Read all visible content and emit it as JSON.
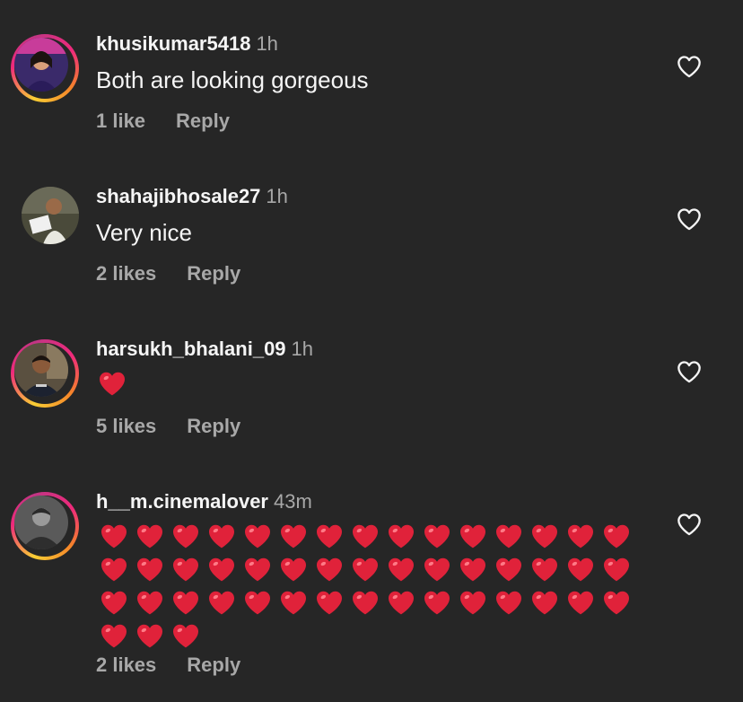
{
  "comments": [
    {
      "username": "khusikumar5418",
      "time": "1h",
      "text": "Both are looking gorgeous",
      "likes": "1 like",
      "reply": "Reply",
      "has_story_ring": true
    },
    {
      "username": "shahajibhosale27",
      "time": "1h",
      "text": "Very nice",
      "likes": "2 likes",
      "reply": "Reply",
      "has_story_ring": false
    },
    {
      "username": "harsukh_bhalani_09",
      "time": "1h",
      "text": "❤️",
      "likes": "5 likes",
      "reply": "Reply",
      "has_story_ring": true
    },
    {
      "username": "h__m.cinemalover",
      "time": "43m",
      "text_hearts": 48,
      "likes": "2 likes",
      "reply": "Reply",
      "has_story_ring": true
    }
  ],
  "icons": {
    "like": "heart-outline-icon",
    "emoji": "red-heart-emoji"
  },
  "colors": {
    "background": "#262626",
    "text": "#f5f5f5",
    "secondary": "#a8a8a8",
    "heart": "#e0223a"
  }
}
